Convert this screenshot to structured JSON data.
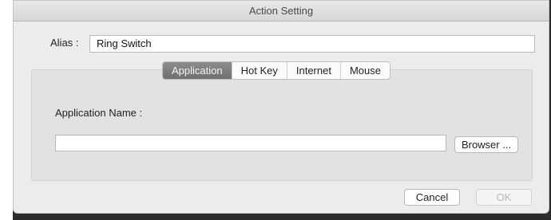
{
  "window": {
    "title": "Action Setting"
  },
  "alias": {
    "label": "Alias :",
    "value": "Ring Switch"
  },
  "tabs": [
    {
      "label": "Application",
      "active": true
    },
    {
      "label": "Hot Key",
      "active": false
    },
    {
      "label": "Internet",
      "active": false
    },
    {
      "label": "Mouse",
      "active": false
    }
  ],
  "application": {
    "name_label": "Application Name :",
    "name_value": "",
    "browser_label": "Browser ..."
  },
  "buttons": {
    "cancel_label": "Cancel",
    "ok_label": "OK",
    "ok_enabled": false
  },
  "colors": {
    "active_tab": "#7d7d7d",
    "window_bg": "#ececec",
    "panel_bg": "#e2e2e2"
  }
}
